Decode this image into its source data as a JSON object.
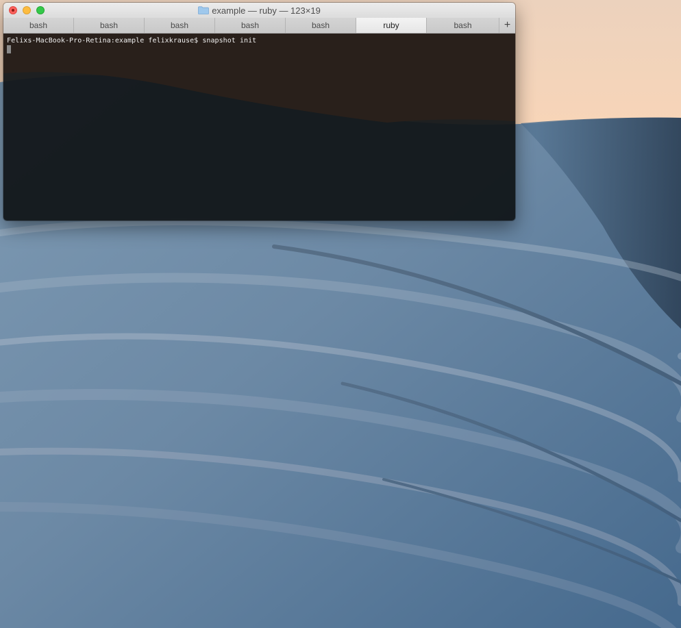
{
  "window": {
    "title": "example — ruby — 123×19",
    "title_icon": "folder-icon"
  },
  "tabs": [
    {
      "label": "bash"
    },
    {
      "label": "bash"
    },
    {
      "label": "bash"
    },
    {
      "label": "bash"
    },
    {
      "label": "bash"
    },
    {
      "label": "ruby",
      "active": true
    },
    {
      "label": "bash"
    }
  ],
  "new_tab_label": "+",
  "terminal": {
    "prompt": "Felixs-MacBook-Pro-Retina:example felixkrause$ snapshot init"
  },
  "colors": {
    "close": "#fc615d",
    "minimize": "#fdbc40",
    "zoom": "#34c84a",
    "terminal_bg": "#111518"
  }
}
